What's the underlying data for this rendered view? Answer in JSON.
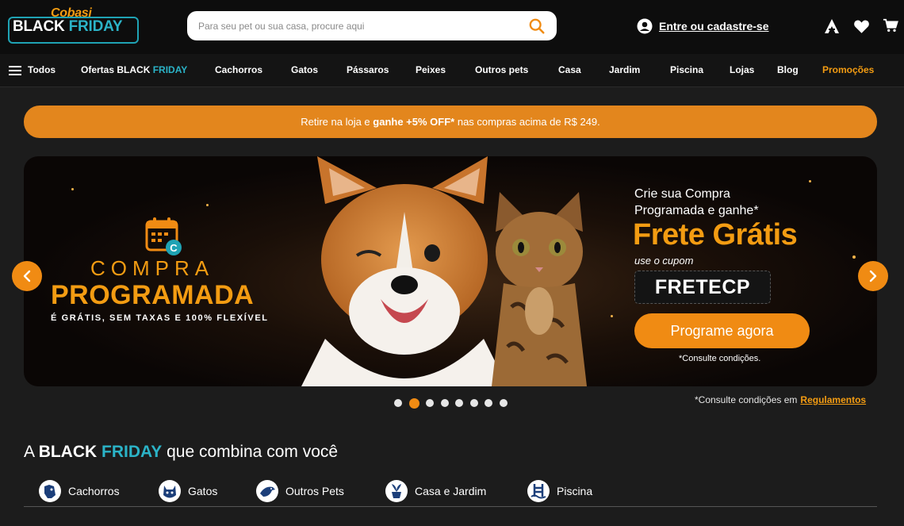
{
  "header": {
    "logo": {
      "brand": "Cobasi",
      "black": "BLACK",
      "friday": "FRIDAY"
    },
    "search": {
      "placeholder": "Para seu pet ou sua casa, procure aqui",
      "icon": "search-icon"
    },
    "account_label": "Entre ou cadastre-se"
  },
  "nav": {
    "all_label": "Todos",
    "offers_prefix": "Ofertas",
    "offers_black": "BLACK",
    "offers_friday": "FRIDAY",
    "items": [
      "Cachorros",
      "Gatos",
      "Pássaros",
      "Peixes",
      "Outros pets",
      "Casa",
      "Jardim",
      "Piscina",
      "Lojas",
      "Blog"
    ],
    "promo_label": "Promoções"
  },
  "promo_bar": {
    "part1": "Retire na loja e ",
    "bold": "ganhe +5% OFF*",
    "part2": " nas compras acima de R$ 249."
  },
  "hero": {
    "compra": "COMPRA",
    "programada": "PROGRAMADA",
    "tagline": "É GRÁTIS, SEM TAXAS E 100% FLEXÍVEL",
    "crie_line1": "Crie sua Compra",
    "crie_line2": "Programada e ganhe*",
    "frete": "Frete Grátis",
    "cupom_label": "use o cupom",
    "cupom_code": "FRETECP",
    "cta": "Programe agora",
    "disclaimer": "*Consulte condições.",
    "active_slide": 2,
    "slide_count": 8
  },
  "regulamentos": {
    "text": "*Consulte condições em",
    "link": "Regulamentos"
  },
  "section": {
    "prefix": "A ",
    "black": "BLACK",
    "friday": "FRIDAY",
    "suffix": " que combina com você"
  },
  "categories": [
    {
      "label": "Cachorros",
      "icon": "dog-icon"
    },
    {
      "label": "Gatos",
      "icon": "cat-icon"
    },
    {
      "label": "Outros Pets",
      "icon": "bird-icon"
    },
    {
      "label": "Casa e Jardim",
      "icon": "plant-icon"
    },
    {
      "label": "Piscina",
      "icon": "pool-icon"
    }
  ],
  "colors": {
    "accent": "#f08b13",
    "brand_teal": "#2bb3c7",
    "background": "#1c1c1c"
  }
}
